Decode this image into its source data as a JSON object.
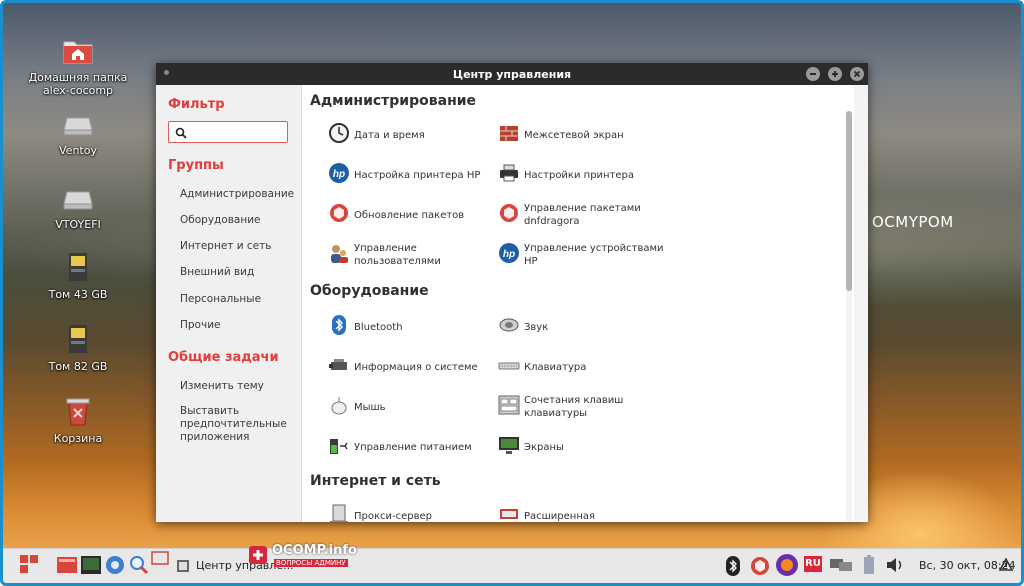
{
  "desktop": {
    "wallpaper_text": "OCMYPOM",
    "icons": [
      {
        "label": "Домашняя папка\nalex-cocomp",
        "icon": "home-folder-icon"
      },
      {
        "label": "Ventoy",
        "icon": "drive-icon"
      },
      {
        "label": "VTOYEFI",
        "icon": "drive-icon"
      },
      {
        "label": "Том 43 GB",
        "icon": "usb-drive-icon"
      },
      {
        "label": "Том 82 GB",
        "icon": "usb-drive-icon"
      },
      {
        "label": "Корзина",
        "icon": "trash-icon"
      }
    ]
  },
  "window": {
    "title": "Центр управления",
    "buttons": [
      "minimize",
      "maximize",
      "close"
    ]
  },
  "sidebar": {
    "filter_title": "Фильтр",
    "search_placeholder": "",
    "groups_title": "Группы",
    "groups": [
      "Администрирование",
      "Оборудование",
      "Интернет и сеть",
      "Внешний вид",
      "Персональные",
      "Прочие"
    ],
    "tasks_title": "Общие задачи",
    "tasks": [
      "Изменить тему",
      "Выставить предпочтительные приложения"
    ]
  },
  "sections": [
    {
      "title": "Администрирование",
      "items": [
        {
          "label": "Дата и время",
          "icon": "clock-icon"
        },
        {
          "label": "Межсетевой экран",
          "icon": "firewall-icon"
        },
        {
          "label": "Настройка принтера HP",
          "icon": "hp-icon"
        },
        {
          "label": "Настройки принтера",
          "icon": "printer-icon"
        },
        {
          "label": "Обновление пакетов",
          "icon": "package-icon"
        },
        {
          "label": "Управление пакетами dnfdragora",
          "icon": "package-icon"
        },
        {
          "label": "Управление пользователями",
          "icon": "users-icon"
        },
        {
          "label": "Управление устройствами HP",
          "icon": "hp-icon"
        }
      ]
    },
    {
      "title": "Оборудование",
      "items": [
        {
          "label": "Bluetooth",
          "icon": "bluetooth-icon"
        },
        {
          "label": "Звук",
          "icon": "speaker-icon"
        },
        {
          "label": "Информация о системе",
          "icon": "system-info-icon"
        },
        {
          "label": "Клавиатура",
          "icon": "keyboard-icon"
        },
        {
          "label": "Мышь",
          "icon": "mouse-icon"
        },
        {
          "label": "Сочетания клавиш клавиатуры",
          "icon": "keyboard-shortcuts-icon"
        },
        {
          "label": "Управление питанием",
          "icon": "battery-icon"
        },
        {
          "label": "Экраны",
          "icon": "display-icon"
        }
      ]
    },
    {
      "title": "Интернет и сеть",
      "items": [
        {
          "label": "Прокси-сервер",
          "icon": "proxy-icon"
        },
        {
          "label": "Расширенная",
          "icon": "network-icon"
        }
      ]
    }
  ],
  "taskbar": {
    "task_label": "Центр управле...",
    "watermark_title": "OCOMP.info",
    "watermark_sub": "ВОПРОСЫ АДМИНУ",
    "tray_lang": "RU",
    "clock": "Вс, 30 окт, 08:24"
  },
  "colors": {
    "accent": "#e23d3d",
    "frame": "#1a8fd0",
    "titlebar": "#2b2b2b"
  }
}
